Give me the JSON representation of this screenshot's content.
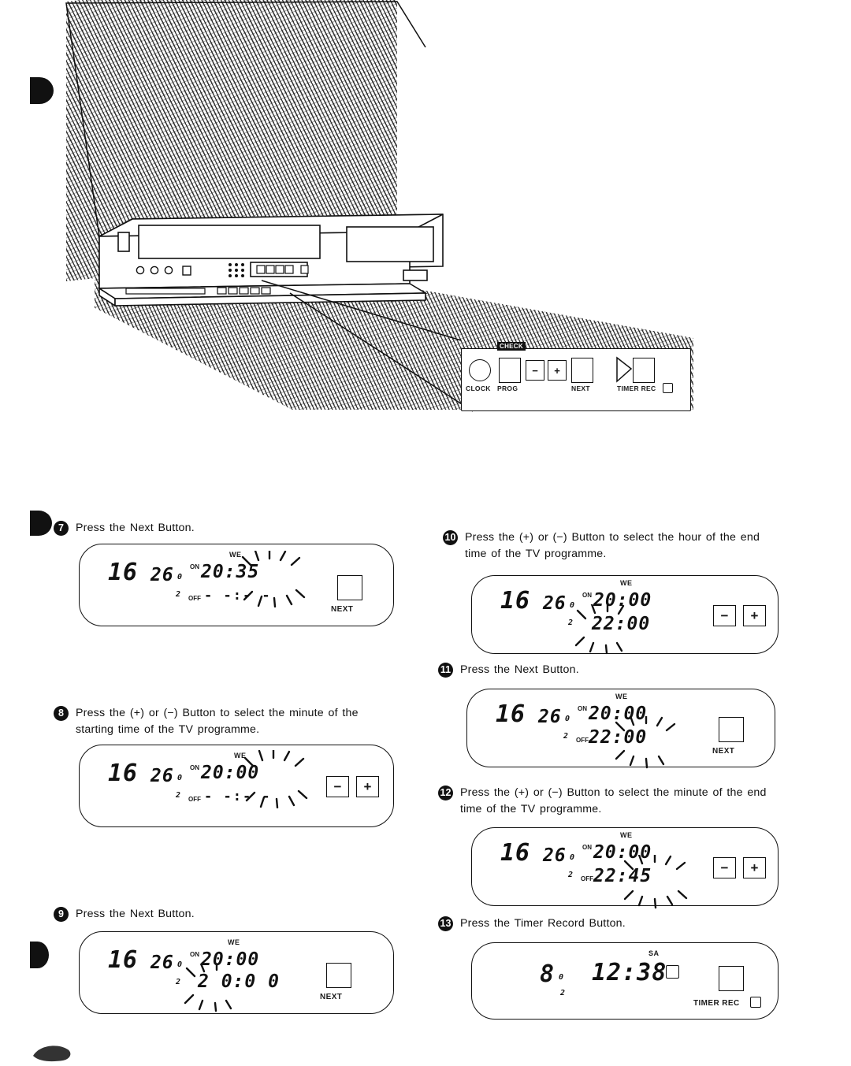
{
  "illustration": {
    "device": "vcr-front-panel",
    "callout": {
      "check_badge": "CHECK",
      "labels": [
        "CLOCK",
        "PROG",
        "NEXT",
        "TIMER REC"
      ],
      "timer_rec_icon": "clock-icon"
    }
  },
  "steps": [
    {
      "number": "7",
      "text": "Press the Next Button.",
      "display": {
        "channel": "16",
        "date": "26",
        "date_sub": "0",
        "on_label": "ON",
        "prog_no": "2",
        "off_label": "OFF",
        "day": "WE",
        "start_time": "20:35",
        "blink": "35",
        "second_row": "- -:- -"
      },
      "control": {
        "type": "next-button",
        "caption": "NEXT"
      }
    },
    {
      "number": "8",
      "text": "Press the (+) or (−) Button to select the minute of the starting time of the TV programme.",
      "display": {
        "channel": "16",
        "date": "26",
        "date_sub": "0",
        "on_label": "ON",
        "prog_no": "2",
        "off_label": "OFF",
        "day": "WE",
        "start_time": "20:00",
        "blink": "00",
        "second_row": "- -:- -"
      },
      "control": {
        "type": "plus-minus-buttons",
        "minus": "−",
        "plus": "+"
      }
    },
    {
      "number": "9",
      "text": "Press the Next Button.",
      "display": {
        "channel": "16",
        "date": "26",
        "date_sub": "0",
        "on_label": "ON",
        "prog_no": "2",
        "day": "WE",
        "start_time": "20:00",
        "second_row": "2 0:0 0",
        "blink": "2 0"
      },
      "control": {
        "type": "next-button",
        "caption": "NEXT"
      }
    },
    {
      "number": "10",
      "text": "Press the (+) or (−) Button to select the hour of the end time of the TV programme.",
      "display": {
        "channel": "16",
        "date": "26",
        "date_sub": "0",
        "on_label": "ON",
        "prog_no": "2",
        "day": "WE",
        "start_time": "20:00",
        "second_row": "22:00",
        "blink": "22"
      },
      "control": {
        "type": "plus-minus-buttons",
        "minus": "−",
        "plus": "+"
      }
    },
    {
      "number": "11",
      "text": "Press the Next Button.",
      "display": {
        "channel": "16",
        "date": "26",
        "date_sub": "0",
        "on_label": "ON",
        "prog_no": "2",
        "off_label": "OFF",
        "day": "WE",
        "start_time": "20:00",
        "second_row": "22:00",
        "blink": "00"
      },
      "control": {
        "type": "next-button",
        "caption": "NEXT"
      }
    },
    {
      "number": "12",
      "text": "Press the (+) or (−) Button to select the minute of the end time of the TV programme.",
      "display": {
        "channel": "16",
        "date": "26",
        "date_sub": "0",
        "on_label": "ON",
        "prog_no": "2",
        "off_label": "OFF",
        "day": "WE",
        "start_time": "20:00",
        "second_row": "22:45",
        "blink": "45"
      },
      "control": {
        "type": "plus-minus-buttons",
        "minus": "−",
        "plus": "+"
      }
    },
    {
      "number": "13",
      "text": "Press the Timer Record Button.",
      "display": {
        "channel": "8",
        "date_sub": "0",
        "prog_no": "2",
        "day": "SA",
        "clock_time": "12:38",
        "timer_icon": "clock-icon"
      },
      "control": {
        "type": "timer-rec-button",
        "caption": "TIMER REC",
        "icon": "clock-icon"
      }
    }
  ]
}
